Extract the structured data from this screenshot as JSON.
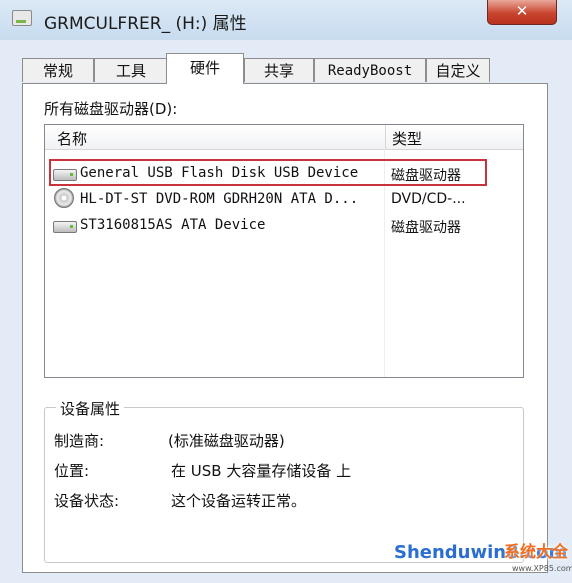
{
  "window": {
    "title": "GRMCULFRER_ (H:) 属性",
    "close_glyph": "✕"
  },
  "tabs": [
    {
      "label": "常规"
    },
    {
      "label": "工具"
    },
    {
      "label": "硬件",
      "active": true
    },
    {
      "label": "共享"
    },
    {
      "label": "ReadyBoost"
    },
    {
      "label": "自定义"
    }
  ],
  "drives": {
    "label": "所有磁盘驱动器(D):",
    "columns": {
      "name": "名称",
      "type": "类型"
    },
    "rows": [
      {
        "name": "General USB Flash Disk USB Device",
        "type": "磁盘驱动器",
        "icon": "usb-drive-icon",
        "highlighted": true
      },
      {
        "name": "HL-DT-ST DVD-ROM GDRH20N ATA D...",
        "type": "DVD/CD-...",
        "icon": "dvd-drive-icon"
      },
      {
        "name": "ST3160815AS ATA Device",
        "type": "磁盘驱动器",
        "icon": "hard-drive-icon"
      }
    ]
  },
  "properties": {
    "title": "设备属性",
    "manufacturer_label": "制造商:",
    "manufacturer_value": "(标准磁盘驱动器)",
    "location_label": "位置:",
    "location_value": "在 USB 大容量存储设备 上",
    "status_label": "设备状态:",
    "status_value": "这个设备运转正常。"
  },
  "watermark": {
    "main": "Shenduwin8.com",
    "cn": "系统大全",
    "sub": "www.XP85.com"
  },
  "colors": {
    "highlight_border": "#c8343a",
    "close_button": "#c9452f"
  }
}
